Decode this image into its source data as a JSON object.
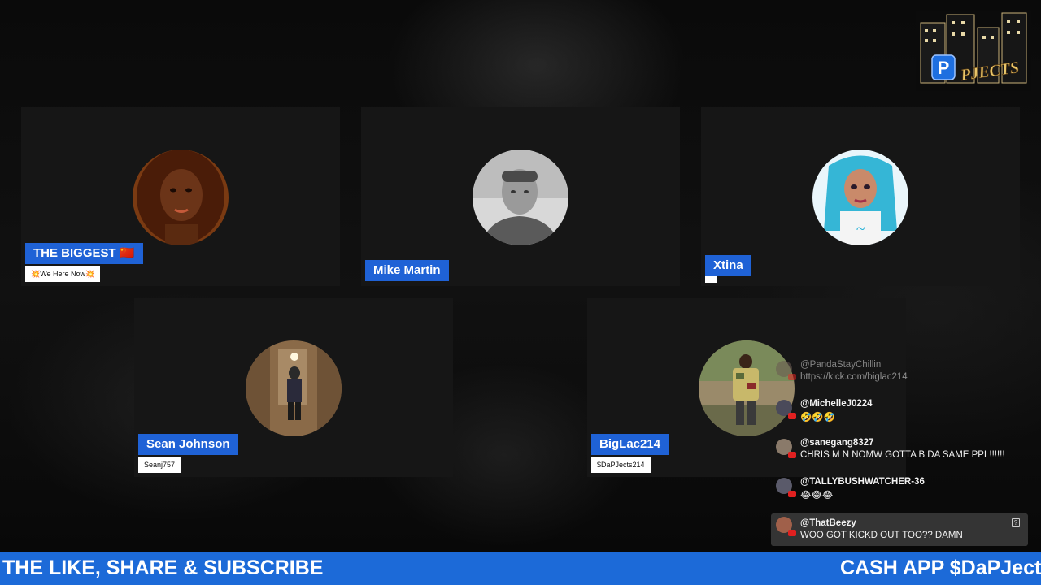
{
  "participants": [
    {
      "name": "THE BIGGEST 🇨🇳",
      "sub": "💥We Here Now💥"
    },
    {
      "name": "Mike Martin",
      "sub": ""
    },
    {
      "name": "Xtina",
      "sub": ""
    },
    {
      "name": "Sean Johnson",
      "sub": "Seanj757"
    },
    {
      "name": "BigLac214",
      "sub": "$DaPJects214"
    }
  ],
  "chat": [
    {
      "user": "@PandaStayChillin",
      "text": "https://kick.com/biglac214"
    },
    {
      "user": "@MichelleJ0224",
      "text": "🤣🤣🤣"
    },
    {
      "user": "@sanegang8327",
      "text": "CHRIS M N NOMW GOTTA B DA SAME PPL!!!!!!"
    },
    {
      "user": "@TALLYBUSHWATCHER-36",
      "text": "😂😂😂"
    },
    {
      "user": "@ThatBeezy",
      "text": "WOO GOT KICKD OUT TOO?? DAMN"
    }
  ],
  "ticker": {
    "left": "THE LIKE, SHARE & SUBSCRIBE",
    "right": "CASH APP $DaPJect"
  },
  "logo": {
    "text": "PJECTS",
    "letter": "P"
  },
  "colors": {
    "name_tag": "#1f62d6",
    "ticker": "#1c6ad8",
    "tile": "#161616"
  }
}
